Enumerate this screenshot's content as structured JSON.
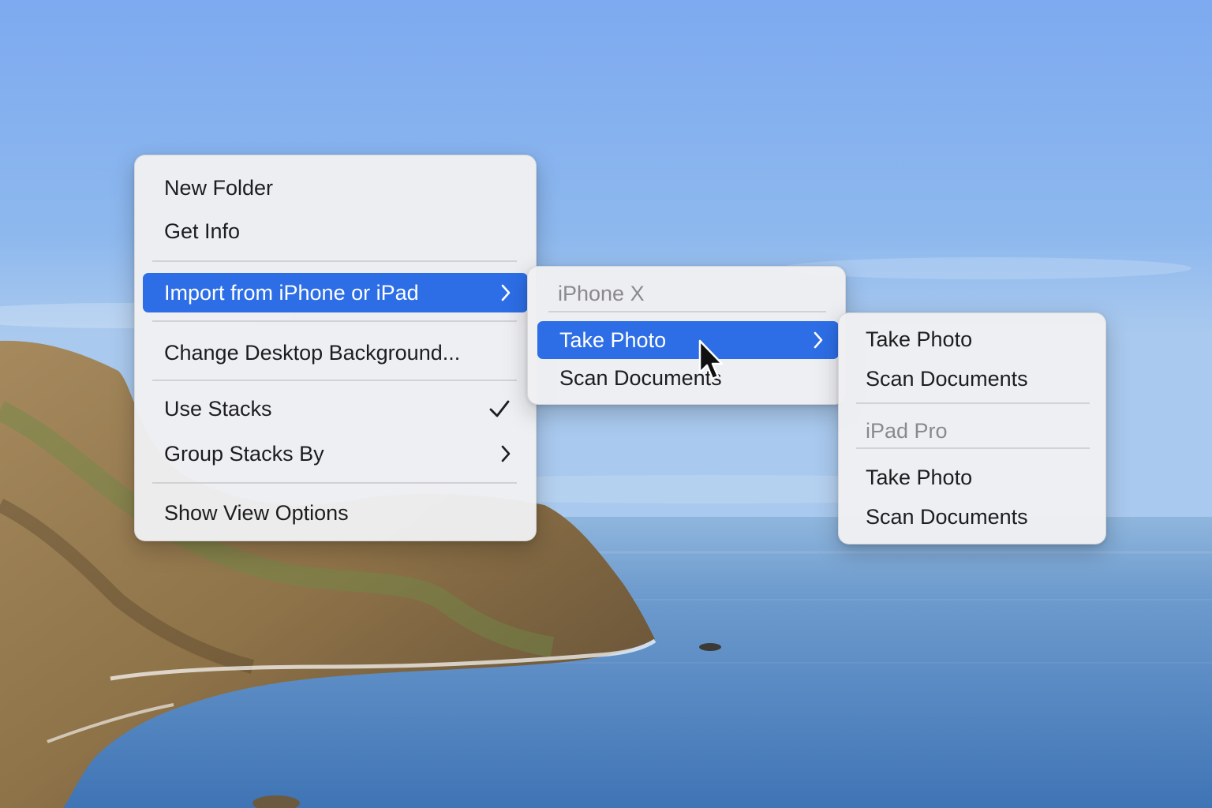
{
  "colors": {
    "highlight": "#2d6ee6",
    "menu_background": "#f0f0f2",
    "text": "#1d1d1f",
    "header_text": "#8a8a8e"
  },
  "context_menu": {
    "items": [
      {
        "label": "New Folder"
      },
      {
        "label": "Get Info"
      },
      {
        "label": "Import from iPhone or iPad",
        "icon": "chevron-right-icon",
        "highlighted": true
      },
      {
        "label": "Change Desktop Background..."
      },
      {
        "label": "Use Stacks",
        "icon": "checkmark-icon",
        "checked": true
      },
      {
        "label": "Group Stacks By",
        "icon": "chevron-right-icon"
      },
      {
        "label": "Show View Options"
      }
    ]
  },
  "import_submenu": {
    "device_header": "iPhone X",
    "items": [
      {
        "label": "Take Photo",
        "icon": "chevron-right-icon",
        "highlighted": true
      },
      {
        "label": "Scan Documents"
      }
    ]
  },
  "device_submenu": {
    "groups": [
      {
        "items": [
          {
            "label": "Take Photo"
          },
          {
            "label": "Scan Documents"
          }
        ]
      },
      {
        "header": "iPad Pro",
        "items": [
          {
            "label": "Take Photo"
          },
          {
            "label": "Scan Documents"
          }
        ]
      }
    ]
  },
  "cursor": {
    "icon": "arrow-pointer-icon"
  }
}
